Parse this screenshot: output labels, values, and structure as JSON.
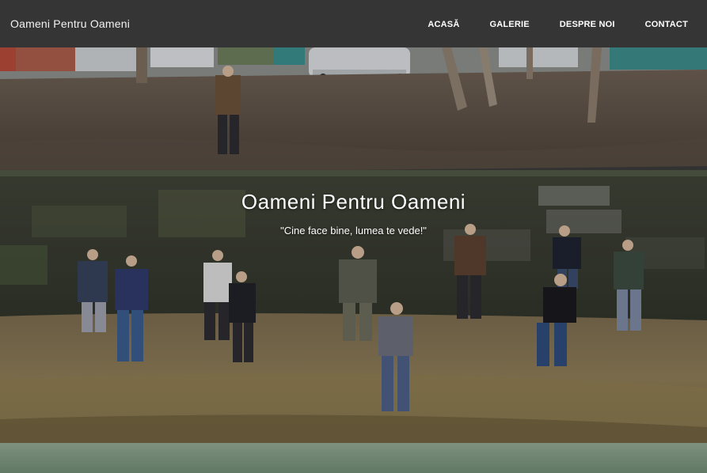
{
  "header": {
    "brand": "Oameni Pentru Oameni",
    "nav": [
      {
        "label": "ACASĂ"
      },
      {
        "label": "GALERIE"
      },
      {
        "label": "DESPRE NOI"
      },
      {
        "label": "CONTACT"
      }
    ]
  },
  "hero": {
    "title": "Oameni Pentru Oameni",
    "subtitle": "\"Cine face bine, lumea te vede!\""
  }
}
